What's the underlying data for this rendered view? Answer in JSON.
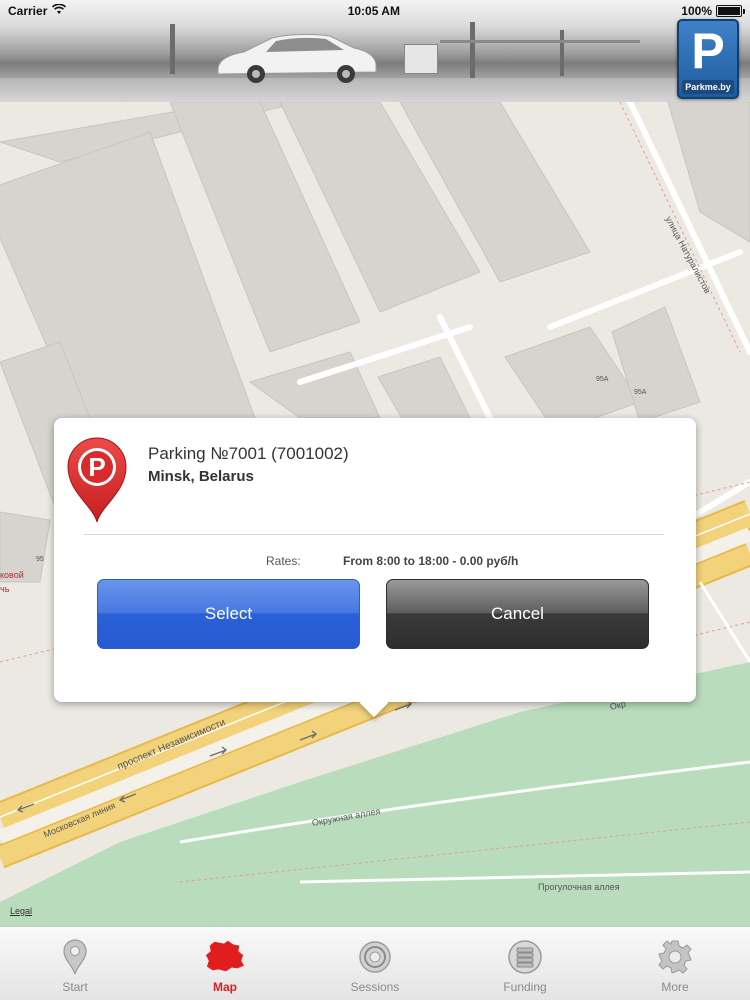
{
  "status_bar": {
    "carrier": "Carrier",
    "time": "10:05 AM",
    "battery": "100%"
  },
  "header": {
    "logo_letter": "P",
    "logo_text": "Parkme.by"
  },
  "map": {
    "street_labels": [
      "улица Натуралистов",
      "проспект Независимости",
      "Московская линия",
      "Окружная аллея",
      "Прогулочная аллея",
      "Окр",
      "95А",
      "95",
      "95А",
      "ковой",
      "чь"
    ],
    "legal": "Legal"
  },
  "popup": {
    "title": "Parking №7001 (7001002)",
    "subtitle": "Minsk, Belarus",
    "rates_label": "Rates:",
    "rates_value": "From 8:00 to 18:00 - 0.00 руб/h",
    "select_label": "Select",
    "cancel_label": "Cancel",
    "pin_letter": "P"
  },
  "tabs": [
    {
      "label": "Start",
      "icon": "location-pin-icon"
    },
    {
      "label": "Map",
      "icon": "belarus-map-icon",
      "active": true
    },
    {
      "label": "Sessions",
      "icon": "sessions-icon"
    },
    {
      "label": "Funding",
      "icon": "coins-icon"
    },
    {
      "label": "More",
      "icon": "gear-icon"
    }
  ],
  "colors": {
    "active_tab": "#e01e1e",
    "select_button": "#2a60d8",
    "cancel_button": "#333333",
    "pin": "#d92b2b",
    "park_green": "#b9dcbd",
    "road_yellow": "#f2d27a"
  }
}
